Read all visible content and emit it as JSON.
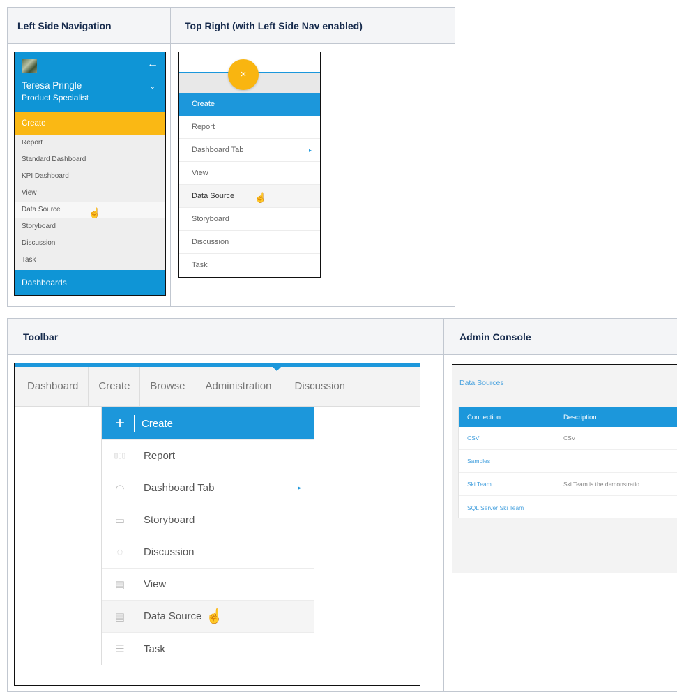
{
  "headers": {
    "left_side_nav": "Left Side Navigation",
    "top_right": "Top Right (with Left Side Nav enabled)",
    "toolbar": "Toolbar",
    "admin_console": "Admin Console"
  },
  "left_nav": {
    "user_name": "Teresa Pringle",
    "user_role": "Product Specialist",
    "create_label": "Create",
    "items": [
      "Report",
      "Standard Dashboard",
      "KPI Dashboard",
      "View",
      "Data Source",
      "Storyboard",
      "Discussion",
      "Task"
    ],
    "bottom_label": "Dashboards"
  },
  "top_right": {
    "fab_icon": "×",
    "items": [
      "Create",
      "Report",
      "Dashboard Tab",
      "View",
      "Data Source",
      "Storyboard",
      "Discussion",
      "Task"
    ]
  },
  "toolbar": {
    "tabs": [
      "Dashboard",
      "Create",
      "Browse",
      "Administration",
      "Discussion"
    ],
    "menu": [
      {
        "label": "Create",
        "icon": "+"
      },
      {
        "label": "Report",
        "icon": "▯▯▯"
      },
      {
        "label": "Dashboard Tab",
        "icon": "◠"
      },
      {
        "label": "Storyboard",
        "icon": "▭"
      },
      {
        "label": "Discussion",
        "icon": "◌"
      },
      {
        "label": "View",
        "icon": "▤"
      },
      {
        "label": "Data Source",
        "icon": "▤"
      },
      {
        "label": "Task",
        "icon": "☰"
      }
    ]
  },
  "admin": {
    "title": "Data Sources",
    "columns": [
      "Connection",
      "Description"
    ],
    "rows": [
      {
        "connection": "CSV",
        "description": "CSV"
      },
      {
        "connection": "Samples",
        "description": ""
      },
      {
        "connection": "Ski Team",
        "description": "Ski Team is the demonstratio"
      },
      {
        "connection": "SQL Server Ski Team",
        "description": ""
      }
    ]
  },
  "colors": {
    "accent_blue": "#1c97db",
    "accent_yellow": "#fab814"
  }
}
